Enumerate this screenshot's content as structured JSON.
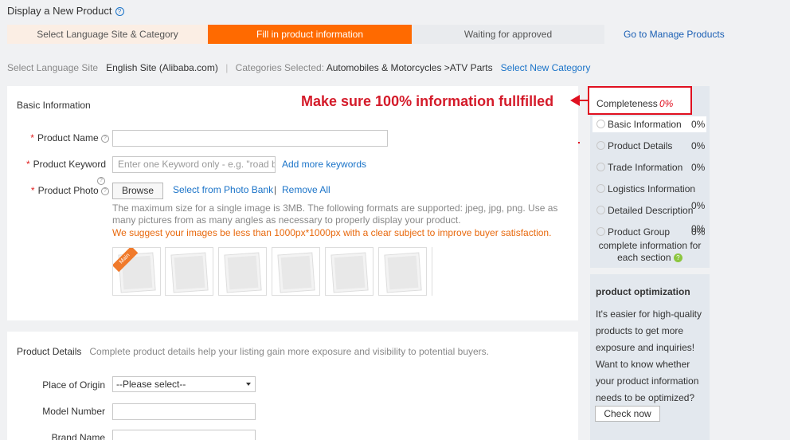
{
  "page": {
    "title": "Display a New Product"
  },
  "steps": [
    {
      "label": "Select Language Site & Category"
    },
    {
      "label": "Fill in product information"
    },
    {
      "label": "Waiting for approved"
    }
  ],
  "goto_manage": "Go to Manage Products",
  "lang_bar": {
    "site_label": "Select Language Site",
    "site_value": "English Site (Alibaba.com)",
    "cat_label": "Categories Selected:",
    "cat_value": "Automobiles & Motorcycles >ATV Parts",
    "new_cat_link": "Select New Category"
  },
  "annotation": "Make sure 100% information fullfilled",
  "basic": {
    "title": "Basic Information",
    "product_name_label": "Product Name",
    "product_name_value": "",
    "keyword_label": "Product Keyword",
    "keyword_placeholder": "Enter one Keyword only - e.g. \"road b",
    "add_keywords": "Add more keywords",
    "photo_label": "Product Photo",
    "browse": "Browse",
    "photo_bank": "Select from Photo Bank",
    "remove_all": "Remove All",
    "photo_sep": "|",
    "hint": "The maximum size for a single image is 3MB. The following formats are supported: jpeg, jpg, png. Use as many pictures from as many angles as necessary to properly display your product.",
    "warning": "We suggest your images be less than 1000px*1000px with a clear subject to improve buyer satisfaction.",
    "main_tag": "Main"
  },
  "details": {
    "title": "Product Details",
    "subtitle": "Complete product details help your listing gain more exposure and visibility to potential buyers.",
    "origin_label": "Place of Origin",
    "origin_value": "--Please select--",
    "model_label": "Model Number",
    "model_value": "",
    "brand_label": "Brand Name",
    "brand_value": ""
  },
  "completeness": {
    "title": "Completeness",
    "value": "0%",
    "sections": [
      {
        "label": "Basic Information",
        "pct": "0%"
      },
      {
        "label": "Product Details",
        "pct": "0%"
      },
      {
        "label": "Trade Information",
        "pct": "0%"
      },
      {
        "label": "Logistics Information",
        "pct": ""
      },
      {
        "label": "Detailed Description",
        "pct": "0%"
      },
      {
        "label": "Product Group",
        "pct": "0%"
      }
    ],
    "overlap_pct": "0%",
    "footer_line1": "complete information for",
    "footer_line2": "each section"
  },
  "optimization": {
    "title": "product optimization",
    "lines": [
      "It's easier for high-quality",
      "products to get more",
      "exposure and inquiries!",
      "Want to know whether",
      "your product information",
      "needs to be optimized?"
    ],
    "button": "Check now"
  },
  "colors": {
    "accent": "#ff6a00",
    "link": "#1a73c8",
    "alert": "#e01020"
  }
}
